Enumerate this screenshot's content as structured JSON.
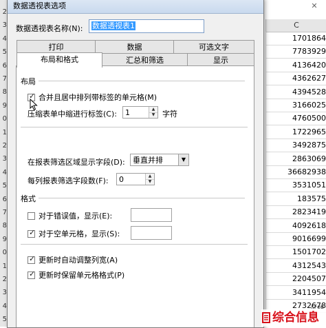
{
  "spreadsheet": {
    "column_header": "C",
    "row_numbers": [
      "2",
      "3",
      "4",
      "5",
      "6",
      "7",
      "8",
      "9",
      "0",
      "1",
      "2",
      "3",
      "4",
      "5",
      "6",
      "7",
      "8",
      "9",
      "0",
      "1",
      "2",
      "3",
      "4",
      "5"
    ],
    "column_c_values": [
      "1701864",
      "7783929",
      "4136420",
      "4362627",
      "4394528",
      "3166025",
      "4760500",
      "1722965",
      "3492875",
      "2863069",
      "36682938",
      "3531051",
      "183575",
      "2823419",
      "4092618",
      "9016699",
      "1501702",
      "4312543",
      "2204507",
      "3411954",
      "2732678"
    ],
    "close_glyph": "✕"
  },
  "dialog": {
    "title": "数据透视表选项",
    "name_label": "数据透视表名称(N):",
    "name_value": "数据透视表1",
    "tabs_row1": [
      "打印",
      "数据",
      "可选文字"
    ],
    "tabs_row2": [
      "布局和格式",
      "汇总和筛选",
      "显示"
    ],
    "layout_section": "布局",
    "merge_label": "合并且居中排列带标签的单元格(M)",
    "merge_checked": true,
    "indent_label": "压缩表单中缩进行标签(C):",
    "indent_value": "1",
    "indent_unit": "字符",
    "filter_area_label": "在报表筛选区域显示字段(D):",
    "filter_area_value": "垂直并排",
    "filter_per_col_label": "每列报表筛选字段数(F):",
    "filter_per_col_value": "0",
    "format_section": "格式",
    "error_label": "对于错误值，显示(E):",
    "error_checked": false,
    "error_value": "",
    "empty_label": "对于空单元格，显示(S):",
    "empty_checked": true,
    "empty_value": "",
    "autofit_label": "更新时自动调整列宽(A)",
    "autofit_checked": true,
    "preserve_label": "更新时保留单元格格式(P)",
    "preserve_checked": true,
    "check_glyph": "✓"
  },
  "watermark": {
    "text": "综合信息",
    "sub": "i.Fob"
  },
  "icons": {
    "cursor": "mouse-pointer-icon",
    "spin_up": "▲",
    "spin_down": "▼",
    "combo_arrow": "▼"
  }
}
